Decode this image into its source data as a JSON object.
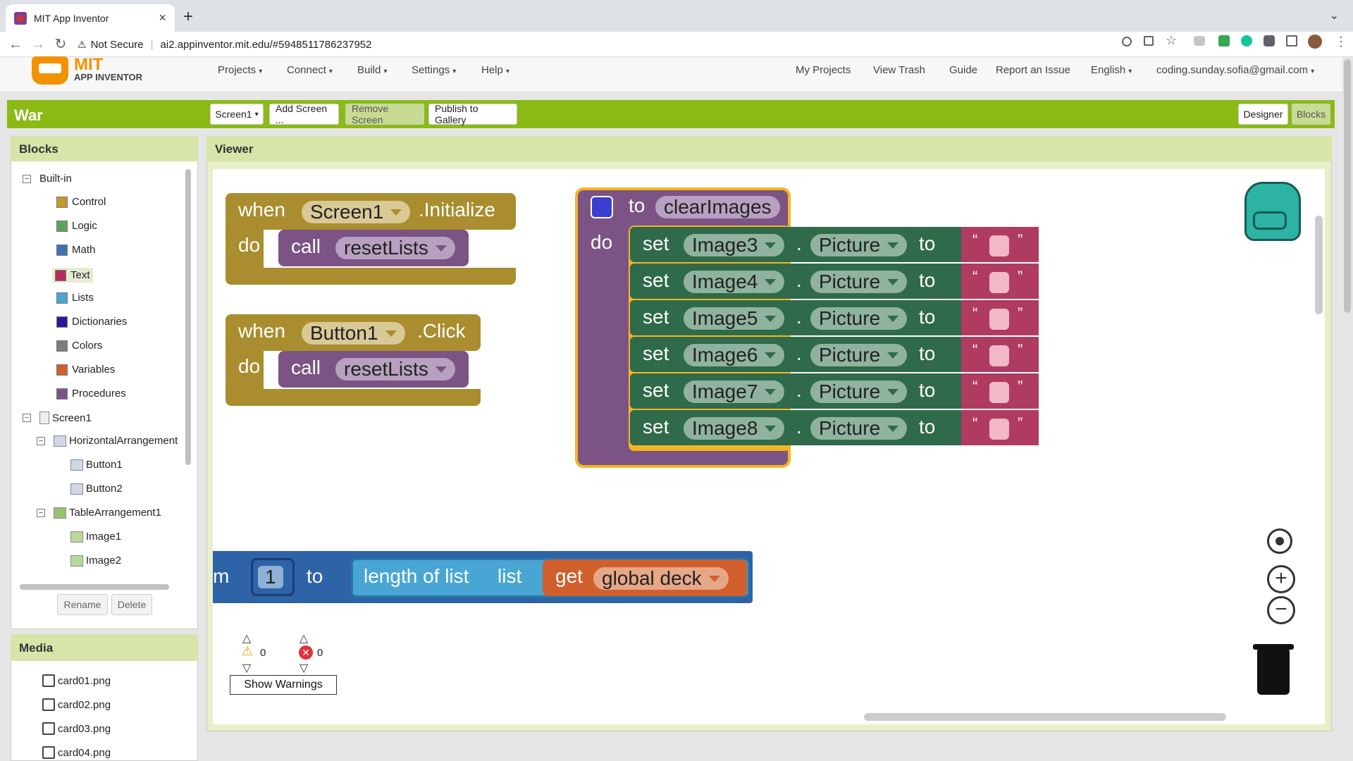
{
  "browser": {
    "tab_title": "MIT App Inventor",
    "tab_close": "×",
    "new_tab": "+",
    "security": "Not Secure",
    "url": "ai2.appinventor.mit.edu/#5948511786237952"
  },
  "app": {
    "logo_line1": "MIT",
    "logo_line2": "APP INVENTOR",
    "menus": [
      "Projects",
      "Connect",
      "Build",
      "Settings",
      "Help"
    ],
    "right_links": [
      "My Projects",
      "View Trash",
      "Guide",
      "Report an Issue"
    ],
    "language": "English",
    "account": "coding.sunday.sofia@gmail.com"
  },
  "project": {
    "name": "War",
    "screen_select": "Screen1",
    "add_screen": "Add Screen ...",
    "remove_screen": "Remove Screen",
    "publish": "Publish to Gallery",
    "designer": "Designer",
    "blocks": "Blocks"
  },
  "blocks_panel": {
    "title": "Blocks",
    "builtin_label": "Built-in",
    "builtin": [
      {
        "label": "Control",
        "color": "#c49a2c"
      },
      {
        "label": "Logic",
        "color": "#5ba55b"
      },
      {
        "label": "Math",
        "color": "#3f71b5"
      },
      {
        "label": "Text",
        "color": "#b32d5e"
      },
      {
        "label": "Lists",
        "color": "#49a6d4"
      },
      {
        "label": "Dictionaries",
        "color": "#2d1799"
      },
      {
        "label": "Colors",
        "color": "#7d7d7d"
      },
      {
        "label": "Variables",
        "color": "#d05f2d"
      },
      {
        "label": "Procedures",
        "color": "#7c5385"
      }
    ],
    "screen": "Screen1",
    "components": [
      {
        "label": "HorizontalArrangement",
        "level": 1
      },
      {
        "label": "Button1",
        "level": 2
      },
      {
        "label": "Button2",
        "level": 2
      },
      {
        "label": "TableArrangement1",
        "level": 1
      },
      {
        "label": "Image1",
        "level": 2
      },
      {
        "label": "Image2",
        "level": 2
      }
    ],
    "rename": "Rename",
    "delete": "Delete"
  },
  "media": {
    "title": "Media",
    "files": [
      "card01.png",
      "card02.png",
      "card03.png",
      "card04.png"
    ]
  },
  "viewer": {
    "title": "Viewer",
    "init_block": {
      "when": "when",
      "component": "Screen1",
      "event": ".Initialize",
      "do": "do",
      "call": "call",
      "proc": "resetLists"
    },
    "click_block": {
      "when": "when",
      "component": "Button1",
      "event": ".Click",
      "do": "do",
      "call": "call",
      "proc": "resetLists"
    },
    "proc_block": {
      "to": "to",
      "name": "clearImages",
      "do": "do",
      "rows": [
        {
          "set": "set",
          "component": "Image3",
          "dot": ".",
          "prop": "Picture",
          "to": "to"
        },
        {
          "set": "set",
          "component": "Image4",
          "dot": ".",
          "prop": "Picture",
          "to": "to"
        },
        {
          "set": "set",
          "component": "Image5",
          "dot": ".",
          "prop": "Picture",
          "to": "to"
        },
        {
          "set": "set",
          "component": "Image6",
          "dot": ".",
          "prop": "Picture",
          "to": "to"
        },
        {
          "set": "set",
          "component": "Image7",
          "dot": ".",
          "prop": "Picture",
          "to": "to"
        },
        {
          "set": "set",
          "component": "Image8",
          "dot": ".",
          "prop": "Picture",
          "to": "to"
        }
      ],
      "open_quote": "“",
      "close_quote": "”"
    },
    "loop_block": {
      "prefix": "m",
      "from": "1",
      "to": "to",
      "length": "length of list",
      "list": "list",
      "get": "get",
      "var": "global deck"
    },
    "warnings": {
      "warn_count": "0",
      "error_count": "0",
      "button": "Show Warnings"
    }
  }
}
